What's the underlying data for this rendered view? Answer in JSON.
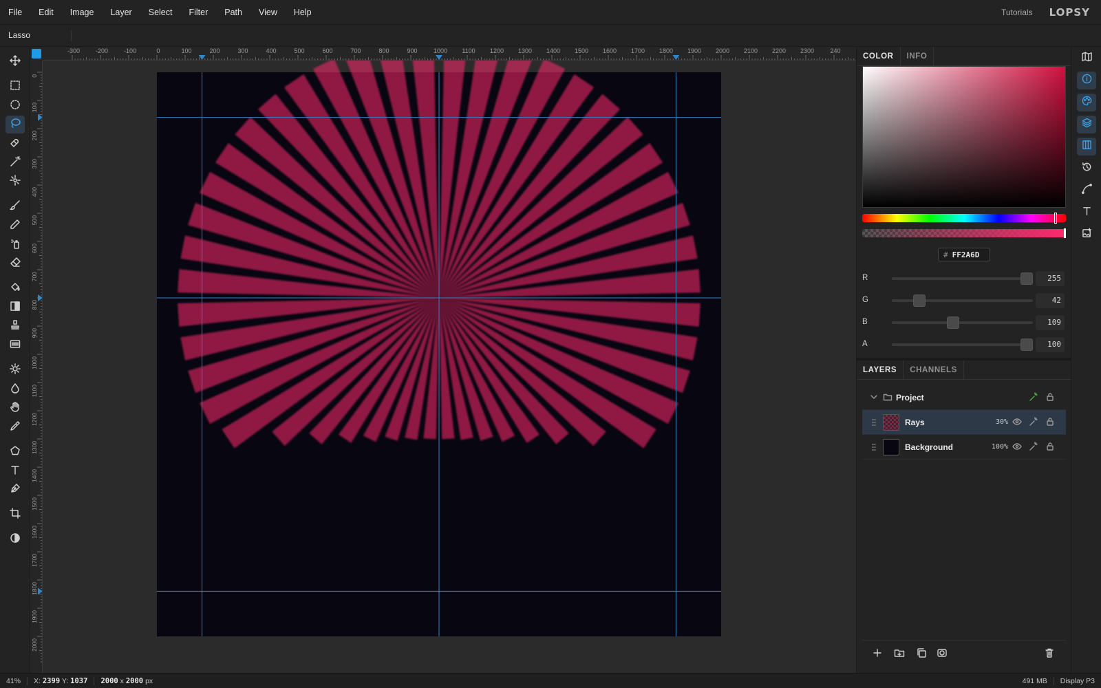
{
  "menu": [
    "File",
    "Edit",
    "Image",
    "Layer",
    "Select",
    "Filter",
    "Path",
    "View",
    "Help"
  ],
  "header": {
    "tutorials": "Tutorials",
    "logo": "LOPSY"
  },
  "tool_options": {
    "tool_name": "Lasso"
  },
  "toolbar": {
    "tools": [
      {
        "name": "move-tool",
        "icon": "move-icon"
      },
      {
        "name": "rect-select-tool",
        "icon": "rect-select-icon"
      },
      {
        "name": "ellipse-select-tool",
        "icon": "ellipse-select-icon"
      },
      {
        "name": "lasso-tool",
        "icon": "lasso-icon",
        "active": true
      },
      {
        "name": "magnetic-lasso-tool",
        "icon": "magnet-lasso-icon"
      },
      {
        "name": "magic-wand-tool",
        "icon": "magic-wand-icon"
      },
      {
        "name": "quick-select-tool",
        "icon": "quick-select-icon"
      },
      {
        "name": "brush-tool",
        "icon": "brush-icon"
      },
      {
        "name": "pencil-tool",
        "icon": "pencil-icon"
      },
      {
        "name": "spray-tool",
        "icon": "spray-icon"
      },
      {
        "name": "eraser-tool",
        "icon": "eraser-icon"
      },
      {
        "name": "fill-tool",
        "icon": "paint-bucket-icon"
      },
      {
        "name": "gradient-tool",
        "icon": "gradient-icon"
      },
      {
        "name": "clone-stamp-tool",
        "icon": "stamp-icon"
      },
      {
        "name": "pattern-tool",
        "icon": "pattern-icon"
      },
      {
        "name": "dodge-tool",
        "icon": "sun-icon"
      },
      {
        "name": "burn-tool",
        "icon": "drop-icon"
      },
      {
        "name": "hand-tool",
        "icon": "hand-icon"
      },
      {
        "name": "eyedropper-tool",
        "icon": "eyedropper-icon"
      },
      {
        "name": "polygon-tool",
        "icon": "pentagon-icon"
      },
      {
        "name": "text-tool",
        "icon": "text-icon"
      },
      {
        "name": "pen-tool",
        "icon": "pen-icon"
      },
      {
        "name": "crop-tool",
        "icon": "crop-icon"
      },
      {
        "name": "color-mode-tool",
        "icon": "contrast-icon"
      }
    ]
  },
  "rulers": {
    "top": [
      "-300",
      "-200",
      "-100",
      "0",
      "100",
      "200",
      "300",
      "400",
      "500",
      "600",
      "700",
      "800",
      "900",
      "1000",
      "1100",
      "1200",
      "1300",
      "1400",
      "1500",
      "1600",
      "1700",
      "1800",
      "1900",
      "2000",
      "2100",
      "2200",
      "2300",
      "240"
    ],
    "left": [
      "0",
      "100",
      "200",
      "300",
      "400",
      "500",
      "600",
      "700",
      "800",
      "900",
      "1000",
      "1100",
      "1200",
      "1300",
      "1400",
      "1500",
      "1600",
      "1700",
      "1800",
      "1900",
      "2000"
    ]
  },
  "canvas": {
    "document_bg": "#070611",
    "ray_color": "#ff2a6d",
    "guide_color": "#2f86c9",
    "guides_vertical_doc_x": [
      160,
      1000,
      1840
    ],
    "guides_horizontal_doc_y": [
      160,
      800,
      1840
    ]
  },
  "color_panel": {
    "tabs": [
      "COLOR",
      "INFO"
    ],
    "hex_prefix": "#",
    "hex": "FF2A6D",
    "channels": [
      {
        "label": "R",
        "value": "255",
        "fraction": 1.0
      },
      {
        "label": "G",
        "value": "42",
        "fraction": 0.165
      },
      {
        "label": "B",
        "value": "109",
        "fraction": 0.427
      },
      {
        "label": "A",
        "value": "100",
        "fraction": 1.0
      }
    ],
    "hue_fraction": 0.95,
    "alpha_fraction": 1.0
  },
  "layers_panel": {
    "tabs": [
      "LAYERS",
      "CHANNELS"
    ],
    "group": {
      "name": "Project"
    },
    "layers": [
      {
        "name": "Rays",
        "opacity": "30%",
        "selected": true
      },
      {
        "name": "Background",
        "opacity": "100%",
        "selected": false
      }
    ],
    "footer_actions": [
      "add-layer-icon",
      "add-folder-icon",
      "duplicate-icon",
      "mask-icon",
      "trash-icon"
    ]
  },
  "right_strip": [
    "map-icon",
    "info-icon",
    "palette-icon",
    "layers-icon",
    "columns-icon",
    "history-icon",
    "path-icon",
    "type-icon",
    "image-add-icon"
  ],
  "status": {
    "zoom": "41%",
    "x_label": "X:",
    "x_value": "2399",
    "y_label": "Y:",
    "y_value": "1037",
    "doc_w": "2000",
    "doc_x": "x",
    "doc_h": "2000",
    "doc_unit": "px",
    "memory": "491 MB",
    "color_profile": "Display P3"
  }
}
